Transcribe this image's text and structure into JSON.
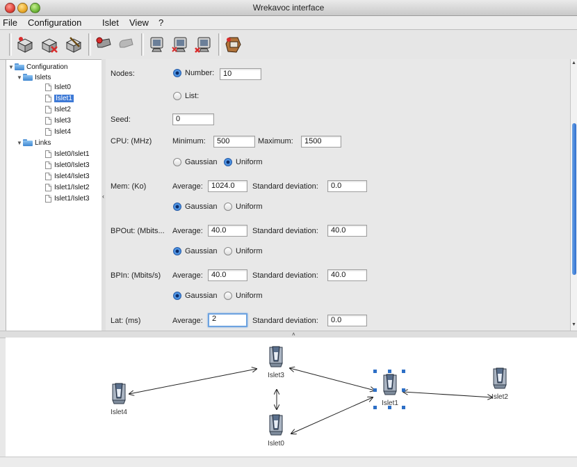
{
  "window": {
    "title": "Wrekavoc interface"
  },
  "menu": [
    "File",
    "Configuration",
    "Islet",
    "View",
    "?"
  ],
  "toolbar": {
    "groups": [
      [
        "add-box-icon",
        "remove-box-icon",
        "edit-box-icon"
      ],
      [
        "add-link-icon",
        "remove-link-icon"
      ],
      [
        "add-monitor-icon",
        "remove-monitor-icon",
        "delete-monitor-icon"
      ],
      [
        "run-icon"
      ]
    ]
  },
  "tree": {
    "root": "Configuration",
    "islets_label": "Islets",
    "islets": [
      "Islet0",
      "Islet1",
      "Islet2",
      "Islet3",
      "Islet4"
    ],
    "selected_islet": "Islet1",
    "links_label": "Links",
    "links": [
      "Islet0/Islet1",
      "Islet0/Islet3",
      "Islet4/Islet3",
      "Islet1/Islet2",
      "Islet1/Islet3"
    ]
  },
  "form": {
    "nodes": {
      "label": "Nodes:",
      "number_label": "Number:",
      "number_value": "10",
      "list_label": "List:",
      "selected": "number"
    },
    "seed": {
      "label": "Seed:",
      "value": "0"
    },
    "cpu": {
      "label": "CPU: (MHz)",
      "min_label": "Minimum:",
      "min_value": "500",
      "max_label": "Maximum:",
      "max_value": "1500",
      "gaussian": "Gaussian",
      "uniform": "Uniform",
      "selected": "uniform"
    },
    "mem": {
      "label": "Mem: (Ko)",
      "avg_label": "Average:",
      "avg_value": "1024.0",
      "sd_label": "Standard deviation:",
      "sd_value": "0.0",
      "gaussian": "Gaussian",
      "uniform": "Uniform",
      "selected": "gaussian"
    },
    "bpout": {
      "label": "BPOut: (Mbits...",
      "avg_label": "Average:",
      "avg_value": "40.0",
      "sd_label": "Standard deviation:",
      "sd_value": "40.0",
      "gaussian": "Gaussian",
      "uniform": "Uniform",
      "selected": "gaussian"
    },
    "bpin": {
      "label": "BPIn: (Mbits/s)",
      "avg_label": "Average:",
      "avg_value": "40.0",
      "sd_label": "Standard deviation:",
      "sd_value": "40.0",
      "gaussian": "Gaussian",
      "uniform": "Uniform",
      "selected": "gaussian"
    },
    "lat": {
      "label": "Lat: (ms)",
      "avg_label": "Average:",
      "avg_value": "2",
      "sd_label": "Standard deviation:",
      "sd_value": "0.0"
    }
  },
  "graph": {
    "nodes": [
      "Islet3",
      "Islet1",
      "Islet2",
      "Islet4",
      "Islet0"
    ],
    "selected_node": "Islet1"
  }
}
